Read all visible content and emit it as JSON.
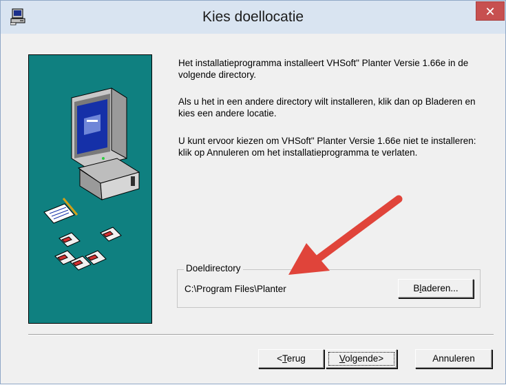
{
  "window": {
    "title": "Kies doellocatie",
    "close_label": "✕"
  },
  "info": {
    "p1": "Het installatieprogramma installeert VHSoft\" Planter Versie 1.66e in de volgende directory.",
    "p2": "Als u het in een andere directory wilt installeren, klik dan op Bladeren en kies een andere locatie.",
    "p3": "U kunt ervoor kiezen om VHSoft\" Planter Versie 1.66e niet te installeren: klik op Annuleren om het installatieprogramma te verlaten."
  },
  "destination": {
    "legend": "Doeldirectory",
    "path": "C:\\Program Files\\Planter",
    "browse_prefix": "B",
    "browse_mnemonic": "l",
    "browse_suffix": "aderen..."
  },
  "buttons": {
    "back_prefix": "<",
    "back_mnemonic": "T",
    "back_suffix": "erug",
    "next_mnemonic": "V",
    "next_suffix": "olgende>",
    "cancel": "Annuleren"
  },
  "colors": {
    "side_panel": "#0f8080",
    "annotation_arrow": "#e0443a",
    "close_button": "#c75050"
  },
  "icons": {
    "app": "setup-computer-icon",
    "close": "close-icon",
    "illustration": "computer-with-floppy-disks-illustration",
    "annotation": "red-arrow-annotation"
  }
}
